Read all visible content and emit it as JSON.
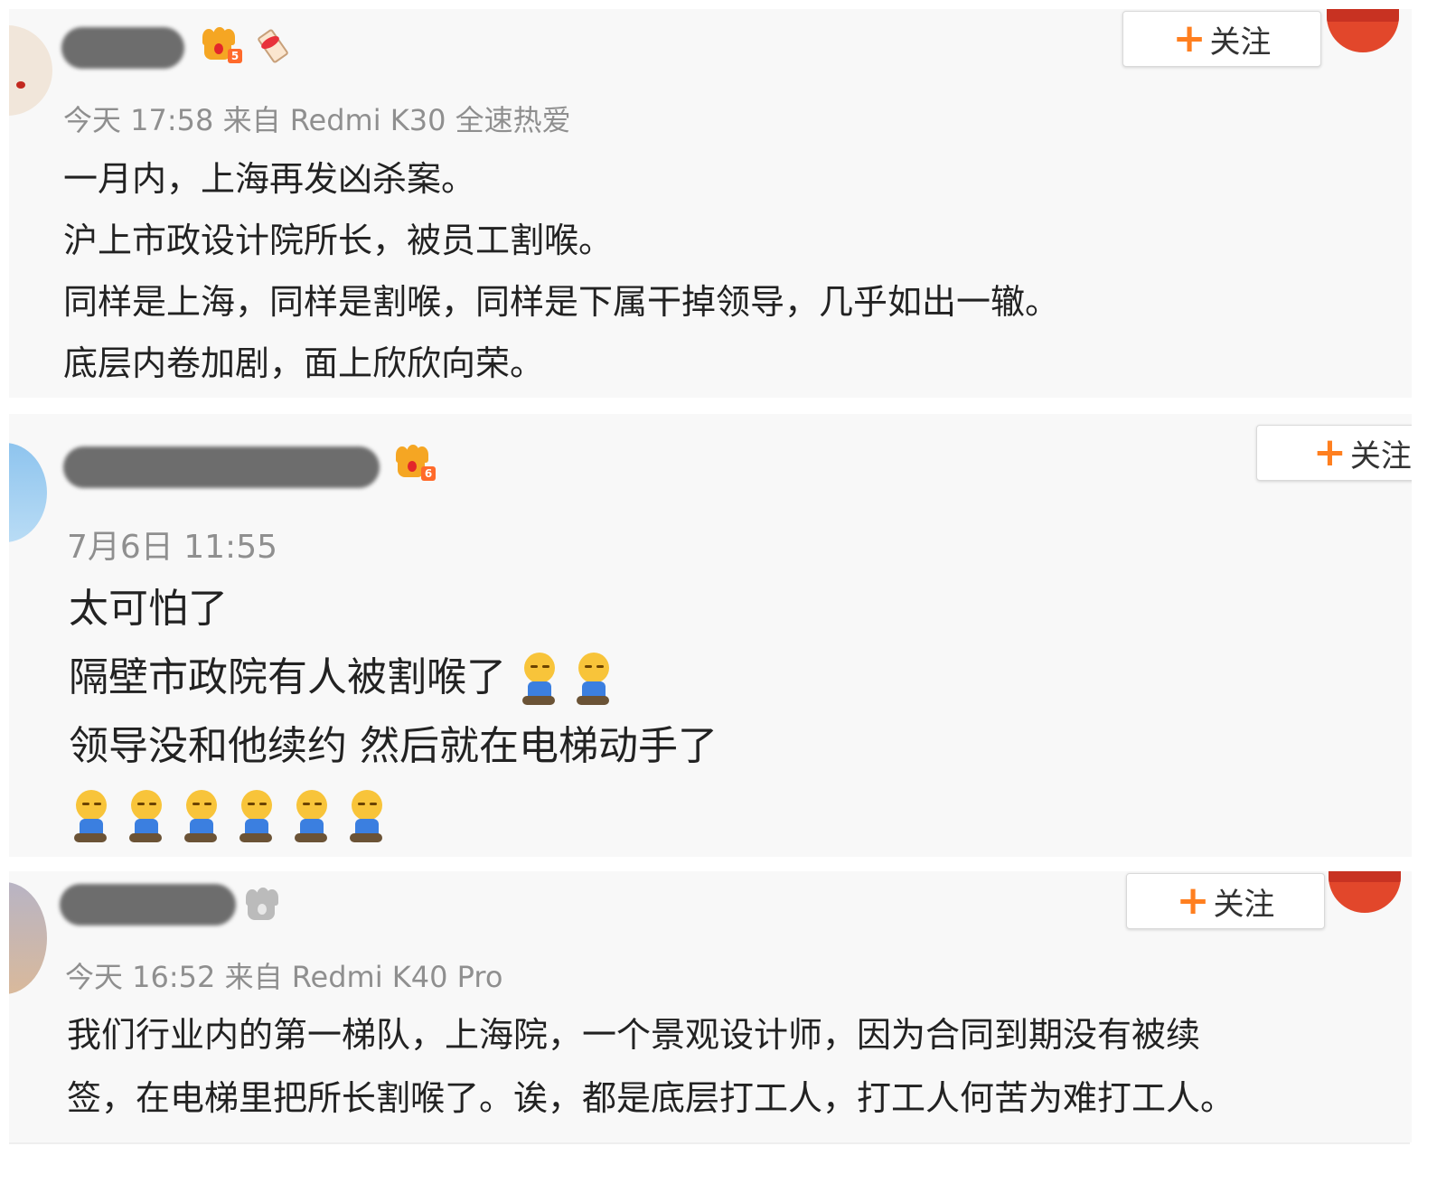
{
  "posts": [
    {
      "follow_label": "关注",
      "level": "5",
      "meta": "今天 17:58 来自 Redmi K30 全速热爱",
      "lines": [
        "一月内，上海再发凶杀案。",
        "沪上市政设计院所长，被员工割喉。",
        "同样是上海，同样是割喉，同样是下属干掉领导，几乎如出一辙。",
        "底层内卷加剧，面上欣欣向荣。"
      ]
    },
    {
      "follow_label": "关注",
      "level": "6",
      "meta": "7月6日 11:55",
      "lines": [
        "太可怕了",
        "隔壁市政院有人被割喉了",
        "领导没和他续约 然后就在电梯动手了"
      ],
      "emoji_name": "doge-sitting-emoji"
    },
    {
      "follow_label": "关注",
      "meta": "今天 16:52 来自 Redmi K40 Pro",
      "lines": [
        "我们行业内的第一梯队，上海院，一个景观设计师，因为合同到期没有被续",
        "签，在电梯里把所长割喉了。诶，都是底层打工人，打工人何苦为难打工人。"
      ]
    }
  ],
  "colors": {
    "accent_orange": "#ff7f1f",
    "meta_gray": "#8f8f8f",
    "badge_red": "#e2472b",
    "panel_bg": "#f8f8f8"
  }
}
